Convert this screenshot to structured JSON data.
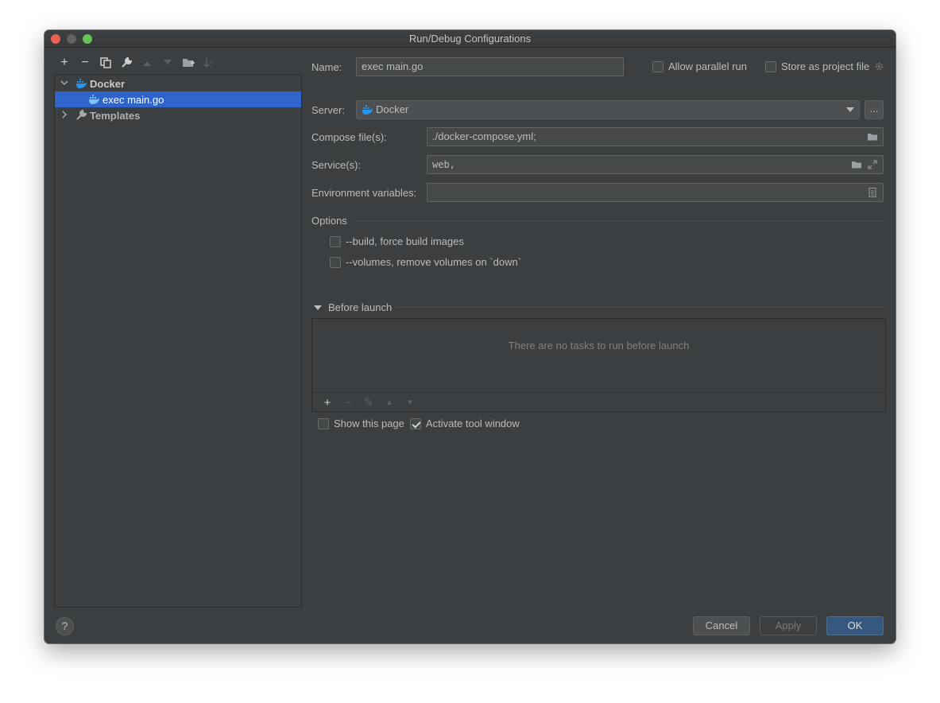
{
  "window": {
    "title": "Run/Debug Configurations"
  },
  "toolbar": {
    "add": "+",
    "remove": "−",
    "copy": "⧉",
    "edit": "🔧",
    "up": "▲",
    "down": "▼",
    "folder": "▣",
    "sort": "⇅"
  },
  "tree": {
    "items": [
      {
        "label": "Docker",
        "expanded": true
      },
      {
        "label": "exec main.go",
        "selected": true
      },
      {
        "label": "Templates",
        "expanded": false
      }
    ]
  },
  "form": {
    "name_label": "Name:",
    "name_value": "exec main.go",
    "allow_parallel_label": "Allow parallel run",
    "store_project_label": "Store as project file",
    "server_label": "Server:",
    "server_value": "Docker",
    "server_more": "...",
    "compose_label": "Compose file(s):",
    "compose_value": "./docker-compose.yml;",
    "services_label": "Service(s):",
    "services_value": "web,",
    "env_label": "Environment variables:",
    "env_value": ""
  },
  "options": {
    "title": "Options",
    "build_label": "--build, force build images",
    "volumes_label": "--volumes, remove volumes on `down`"
  },
  "before_launch": {
    "title": "Before launch",
    "empty_text": "There are no tasks to run before launch",
    "tools": {
      "add": "+",
      "remove": "−",
      "edit": "✎",
      "up": "▲",
      "down": "▼"
    },
    "show_page_label": "Show this page",
    "show_page_checked": false,
    "activate_tool_label": "Activate tool window",
    "activate_tool_checked": true
  },
  "buttons": {
    "help": "?",
    "cancel": "Cancel",
    "apply": "Apply",
    "ok": "OK"
  },
  "colors": {
    "background": "#3c3f41",
    "selection": "#2f65ca",
    "ok_button": "#365880",
    "docker_blue": "#2496ed"
  }
}
